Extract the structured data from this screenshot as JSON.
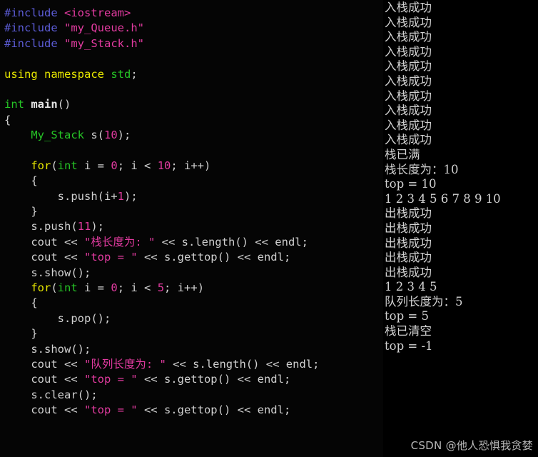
{
  "window": {
    "title_nub": "",
    "editor_background": "#050505",
    "console_background": "#000000"
  },
  "theme": {
    "preprocessor_color": "#5c5cd6",
    "string_color": "#e23ba0",
    "keyword_color": "#e8e800",
    "type_color": "#26c426",
    "number_color": "#e23ba0",
    "plain_color": "#d0d0d0",
    "console_text_color": "#d2d2d2"
  },
  "editor": {
    "language": "C++",
    "lines": [
      [
        {
          "t": "#include ",
          "c": "tok-pre"
        },
        {
          "t": "<iostream>",
          "c": "tok-str"
        }
      ],
      [
        {
          "t": "#include ",
          "c": "tok-pre"
        },
        {
          "t": "\"my_Queue.h\"",
          "c": "tok-str"
        }
      ],
      [
        {
          "t": "#include ",
          "c": "tok-pre"
        },
        {
          "t": "\"my_Stack.h\"",
          "c": "tok-str"
        }
      ],
      [
        {
          "t": "",
          "c": "tok-plain"
        }
      ],
      [
        {
          "t": "using namespace ",
          "c": "tok-kw"
        },
        {
          "t": "std",
          "c": "tok-type"
        },
        {
          "t": ";",
          "c": "tok-plain"
        }
      ],
      [
        {
          "t": "",
          "c": "tok-plain"
        }
      ],
      [
        {
          "t": "int ",
          "c": "tok-type"
        },
        {
          "t": "main",
          "c": "tok-fn"
        },
        {
          "t": "()",
          "c": "tok-plain"
        }
      ],
      [
        {
          "t": "{",
          "c": "tok-plain"
        }
      ],
      [
        {
          "t": "    ",
          "c": "tok-plain"
        },
        {
          "t": "My_Stack",
          "c": "tok-type"
        },
        {
          "t": " s",
          "c": "tok-plain"
        },
        {
          "t": "(",
          "c": "tok-punc"
        },
        {
          "t": "10",
          "c": "tok-num"
        },
        {
          "t": ")",
          "c": "tok-punc"
        },
        {
          "t": ";",
          "c": "tok-plain"
        }
      ],
      [
        {
          "t": "",
          "c": "tok-plain"
        }
      ],
      [
        {
          "t": "    ",
          "c": "tok-plain"
        },
        {
          "t": "for",
          "c": "tok-kw"
        },
        {
          "t": "(",
          "c": "tok-punc"
        },
        {
          "t": "int",
          "c": "tok-type"
        },
        {
          "t": " i = ",
          "c": "tok-plain"
        },
        {
          "t": "0",
          "c": "tok-num"
        },
        {
          "t": "; i < ",
          "c": "tok-plain"
        },
        {
          "t": "10",
          "c": "tok-num"
        },
        {
          "t": "; i++)",
          "c": "tok-plain"
        }
      ],
      [
        {
          "t": "    {",
          "c": "tok-plain"
        }
      ],
      [
        {
          "t": "        s.push(i+",
          "c": "tok-plain"
        },
        {
          "t": "1",
          "c": "tok-num"
        },
        {
          "t": ");",
          "c": "tok-plain"
        }
      ],
      [
        {
          "t": "    }",
          "c": "tok-plain"
        }
      ],
      [
        {
          "t": "    s.push(",
          "c": "tok-plain"
        },
        {
          "t": "11",
          "c": "tok-num"
        },
        {
          "t": ");",
          "c": "tok-plain"
        }
      ],
      [
        {
          "t": "    cout << ",
          "c": "tok-plain"
        },
        {
          "t": "\"栈长度为: \"",
          "c": "tok-str"
        },
        {
          "t": " << s.length() << endl;",
          "c": "tok-plain"
        }
      ],
      [
        {
          "t": "    cout << ",
          "c": "tok-plain"
        },
        {
          "t": "\"top = \"",
          "c": "tok-str"
        },
        {
          "t": " << s.gettop() << endl;",
          "c": "tok-plain"
        }
      ],
      [
        {
          "t": "    s.show();",
          "c": "tok-plain"
        }
      ],
      [
        {
          "t": "    ",
          "c": "tok-plain"
        },
        {
          "t": "for",
          "c": "tok-kw"
        },
        {
          "t": "(",
          "c": "tok-punc"
        },
        {
          "t": "int",
          "c": "tok-type"
        },
        {
          "t": " i = ",
          "c": "tok-plain"
        },
        {
          "t": "0",
          "c": "tok-num"
        },
        {
          "t": "; i < ",
          "c": "tok-plain"
        },
        {
          "t": "5",
          "c": "tok-num"
        },
        {
          "t": "; i++)",
          "c": "tok-plain"
        }
      ],
      [
        {
          "t": "    {",
          "c": "tok-plain"
        }
      ],
      [
        {
          "t": "        s.pop();",
          "c": "tok-plain"
        }
      ],
      [
        {
          "t": "    }",
          "c": "tok-plain"
        }
      ],
      [
        {
          "t": "    s.show();",
          "c": "tok-plain"
        }
      ],
      [
        {
          "t": "    cout << ",
          "c": "tok-plain"
        },
        {
          "t": "\"队列长度为: \"",
          "c": "tok-str"
        },
        {
          "t": " << s.length() << endl;",
          "c": "tok-plain"
        }
      ],
      [
        {
          "t": "    cout << ",
          "c": "tok-plain"
        },
        {
          "t": "\"top = \"",
          "c": "tok-str"
        },
        {
          "t": " << s.gettop() << endl;",
          "c": "tok-plain"
        }
      ],
      [
        {
          "t": "    s.clear();",
          "c": "tok-plain"
        }
      ],
      [
        {
          "t": "    cout << ",
          "c": "tok-plain"
        },
        {
          "t": "\"top = \"",
          "c": "tok-str"
        },
        {
          "t": " << s.gettop() << endl;",
          "c": "tok-plain"
        }
      ]
    ]
  },
  "console": {
    "lines": [
      "入栈成功",
      "入栈成功",
      "入栈成功",
      "入栈成功",
      "入栈成功",
      "入栈成功",
      "入栈成功",
      "入栈成功",
      "入栈成功",
      "入栈成功",
      "栈已满",
      "栈长度为：10",
      "top = 10",
      "1 2 3 4 5 6 7 8 9 10",
      "出栈成功",
      "出栈成功",
      "出栈成功",
      "出栈成功",
      "出栈成功",
      "1 2 3 4 5",
      "队列长度为：5",
      "top = 5",
      "栈已清空",
      "top = -1"
    ]
  },
  "watermark": {
    "text": "CSDN @他人恐惧我贪婪"
  }
}
